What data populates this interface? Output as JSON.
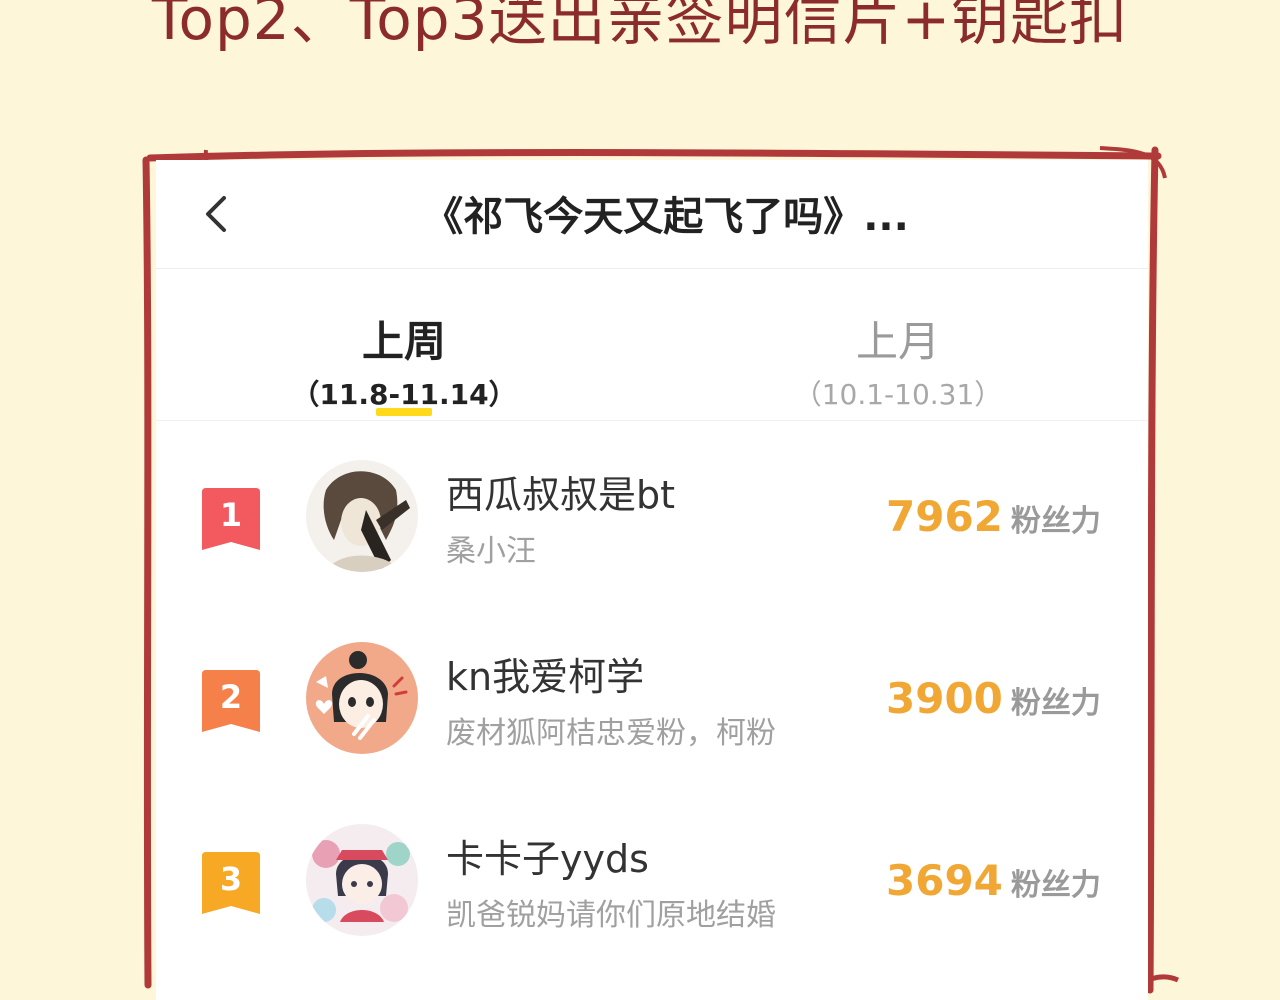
{
  "banner": {
    "text": "Top2、Top3送出亲签明信片+钥匙扣"
  },
  "header": {
    "back_icon": "chevron-left-icon",
    "title": "《祁飞今天又起飞了吗》..."
  },
  "tabs": [
    {
      "label": "上周",
      "range": "（11.8-11.14）",
      "active": true
    },
    {
      "label": "上月",
      "range": "（10.1-10.31）",
      "active": false
    }
  ],
  "ranking": [
    {
      "rank": "1",
      "name": "西瓜叔叔是bt",
      "subtitle": "桑小汪",
      "score": "7962",
      "unit": "粉丝力",
      "badge_color": "#f25a5f",
      "avatar_icon": "avatar-sketch"
    },
    {
      "rank": "2",
      "name": "kn我爱柯学",
      "subtitle": "废材狐阿桔忠爱粉，柯粉",
      "score": "3900",
      "unit": "粉丝力",
      "badge_color": "#f5804a",
      "avatar_icon": "avatar-girl"
    },
    {
      "rank": "3",
      "name": "卡卡子yyds",
      "subtitle": "凯爸锐妈请你们原地结婚",
      "score": "3694",
      "unit": "粉丝力",
      "badge_color": "#f7a824",
      "avatar_icon": "avatar-illustration"
    }
  ],
  "colors": {
    "frame": "#b03a3a",
    "background": "#fdf6d9",
    "accent_yellow": "#ffd91a",
    "score": "#f0a733"
  }
}
